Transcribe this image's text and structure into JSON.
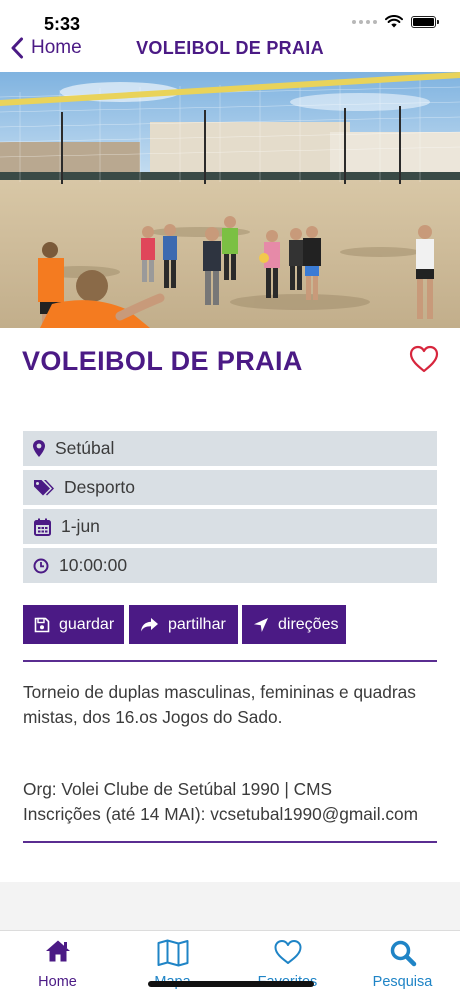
{
  "status_bar": {
    "time": "5:33"
  },
  "nav": {
    "back_label": "Home",
    "title": "VOLEIBOL DE PRAIA"
  },
  "event": {
    "title": "VOLEIBOL DE PRAIA",
    "location": "Setúbal",
    "category": "Desporto",
    "date": "1-jun",
    "time": "10:00:00"
  },
  "actions": {
    "save": "guardar",
    "share": "partilhar",
    "directions": "direções"
  },
  "description": "Torneio de duplas masculinas, femininas e quadras mistas, dos 16.os Jogos do Sado.",
  "organizer": "Org: Volei Clube de Setúbal 1990 | CMS",
  "registration": "Inscrições (até 14 MAI): vcsetubal1990@gmail.com",
  "tabs": [
    {
      "label": "Home",
      "icon": "home-icon",
      "active": true
    },
    {
      "label": "Mapa",
      "icon": "map-icon",
      "active": false
    },
    {
      "label": "Favoritos",
      "icon": "heart-icon",
      "active": false
    },
    {
      "label": "Pesquisa",
      "icon": "search-icon",
      "active": false
    }
  ],
  "colors": {
    "primary": "#4b1a85",
    "accent_red": "#d7263d",
    "tab_blue": "#1f84c6",
    "info_bg": "#d9dfe4"
  }
}
